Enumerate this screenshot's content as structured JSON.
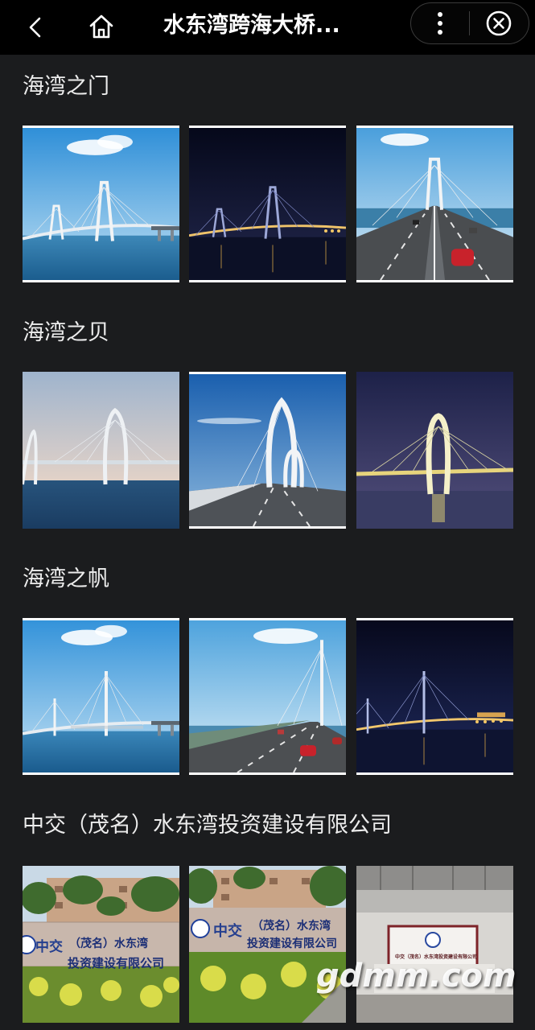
{
  "header": {
    "title": "水东湾跨海大桥...",
    "back_icon": "chevron-left-icon",
    "home_icon": "home-icon",
    "more_icon": "more-vertical-icon",
    "close_icon": "close-circle-icon"
  },
  "sections": [
    {
      "title": "海湾之门",
      "images": [
        "day-bridge-view",
        "night-bridge-view",
        "road-deck-view"
      ]
    },
    {
      "title": "海湾之贝",
      "images": [
        "dusk-arch-bridge",
        "arch-tower-road-view",
        "night-arch-lit"
      ]
    },
    {
      "title": "海湾之帆",
      "images": [
        "day-sail-bridge",
        "sail-tower-road-view",
        "night-sail-bridge"
      ]
    },
    {
      "title": "中交（茂名）水东湾投资建设有限公司",
      "images": [
        "company-sign-wall",
        "company-sign-wall-closeup",
        "company-lobby"
      ]
    }
  ],
  "signs": {
    "logo_text": "中交",
    "line1": "（茂名）水东湾",
    "line2": "投资建设有限公司",
    "lobby_text": "中交（茂名）水东湾投资建设有限公司"
  },
  "watermark": "gdmm.com",
  "colors": {
    "background": "#1b1c1e",
    "topbar": "#000000",
    "text": "#ececec"
  }
}
